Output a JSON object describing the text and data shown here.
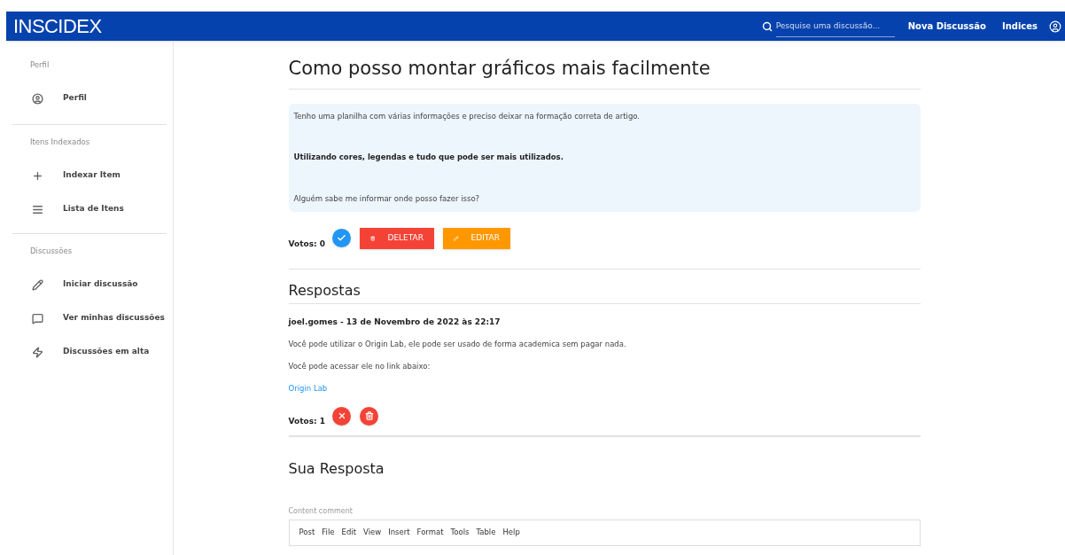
{
  "header": {
    "logo": "INSCIDEX",
    "search": {
      "placeholder": "Pesquise uma discussão..."
    },
    "links": [
      "Nova Discussão",
      "Indices"
    ]
  },
  "sidebar": {
    "sections": [
      {
        "title": "Perfil",
        "items": [
          "Perfil"
        ]
      },
      {
        "title": "Itens Indexados",
        "items": [
          "Indexar Item",
          "Lista de Itens"
        ]
      },
      {
        "title": "Discussões",
        "items": [
          "Iniciar discussão",
          "Ver minhas discussões",
          "Discussões em alta"
        ]
      }
    ]
  },
  "question": {
    "title": "Como posso montar gráficos mais facilmente",
    "paragraphs": [
      {
        "text": "Tenho uma planilha com várias informações e preciso deixar na formação correta de artigo.",
        "bold": false
      },
      {
        "text": "Utilizando cores, legendas e tudo que pode ser mais utilizados.",
        "bold": true
      },
      {
        "text": "Alguém sabe me informar onde posso fazer isso?",
        "bold": false
      }
    ],
    "votes": "Votos: 0",
    "buttons": [
      "DELETAR",
      "EDITAR"
    ]
  },
  "answers_title": "Respostas",
  "answers": [
    {
      "author": "joel.gomes - 13 de Novembro de 2022 às 22:17",
      "paragraphs": [
        "Você pode utilizar o Origin Lab, ele pode ser usado de forma academica sem pagar nada.",
        "Você pode acessar ele no link abaixo:"
      ],
      "link": "Origin Lab",
      "votes": "Votos: 1"
    }
  ],
  "reply": {
    "title": "Sua Resposta",
    "label": "Content comment",
    "menu": [
      "Post",
      "File",
      "Edit",
      "View",
      "Insert",
      "Format",
      "Tools",
      "Table",
      "Help"
    ]
  }
}
